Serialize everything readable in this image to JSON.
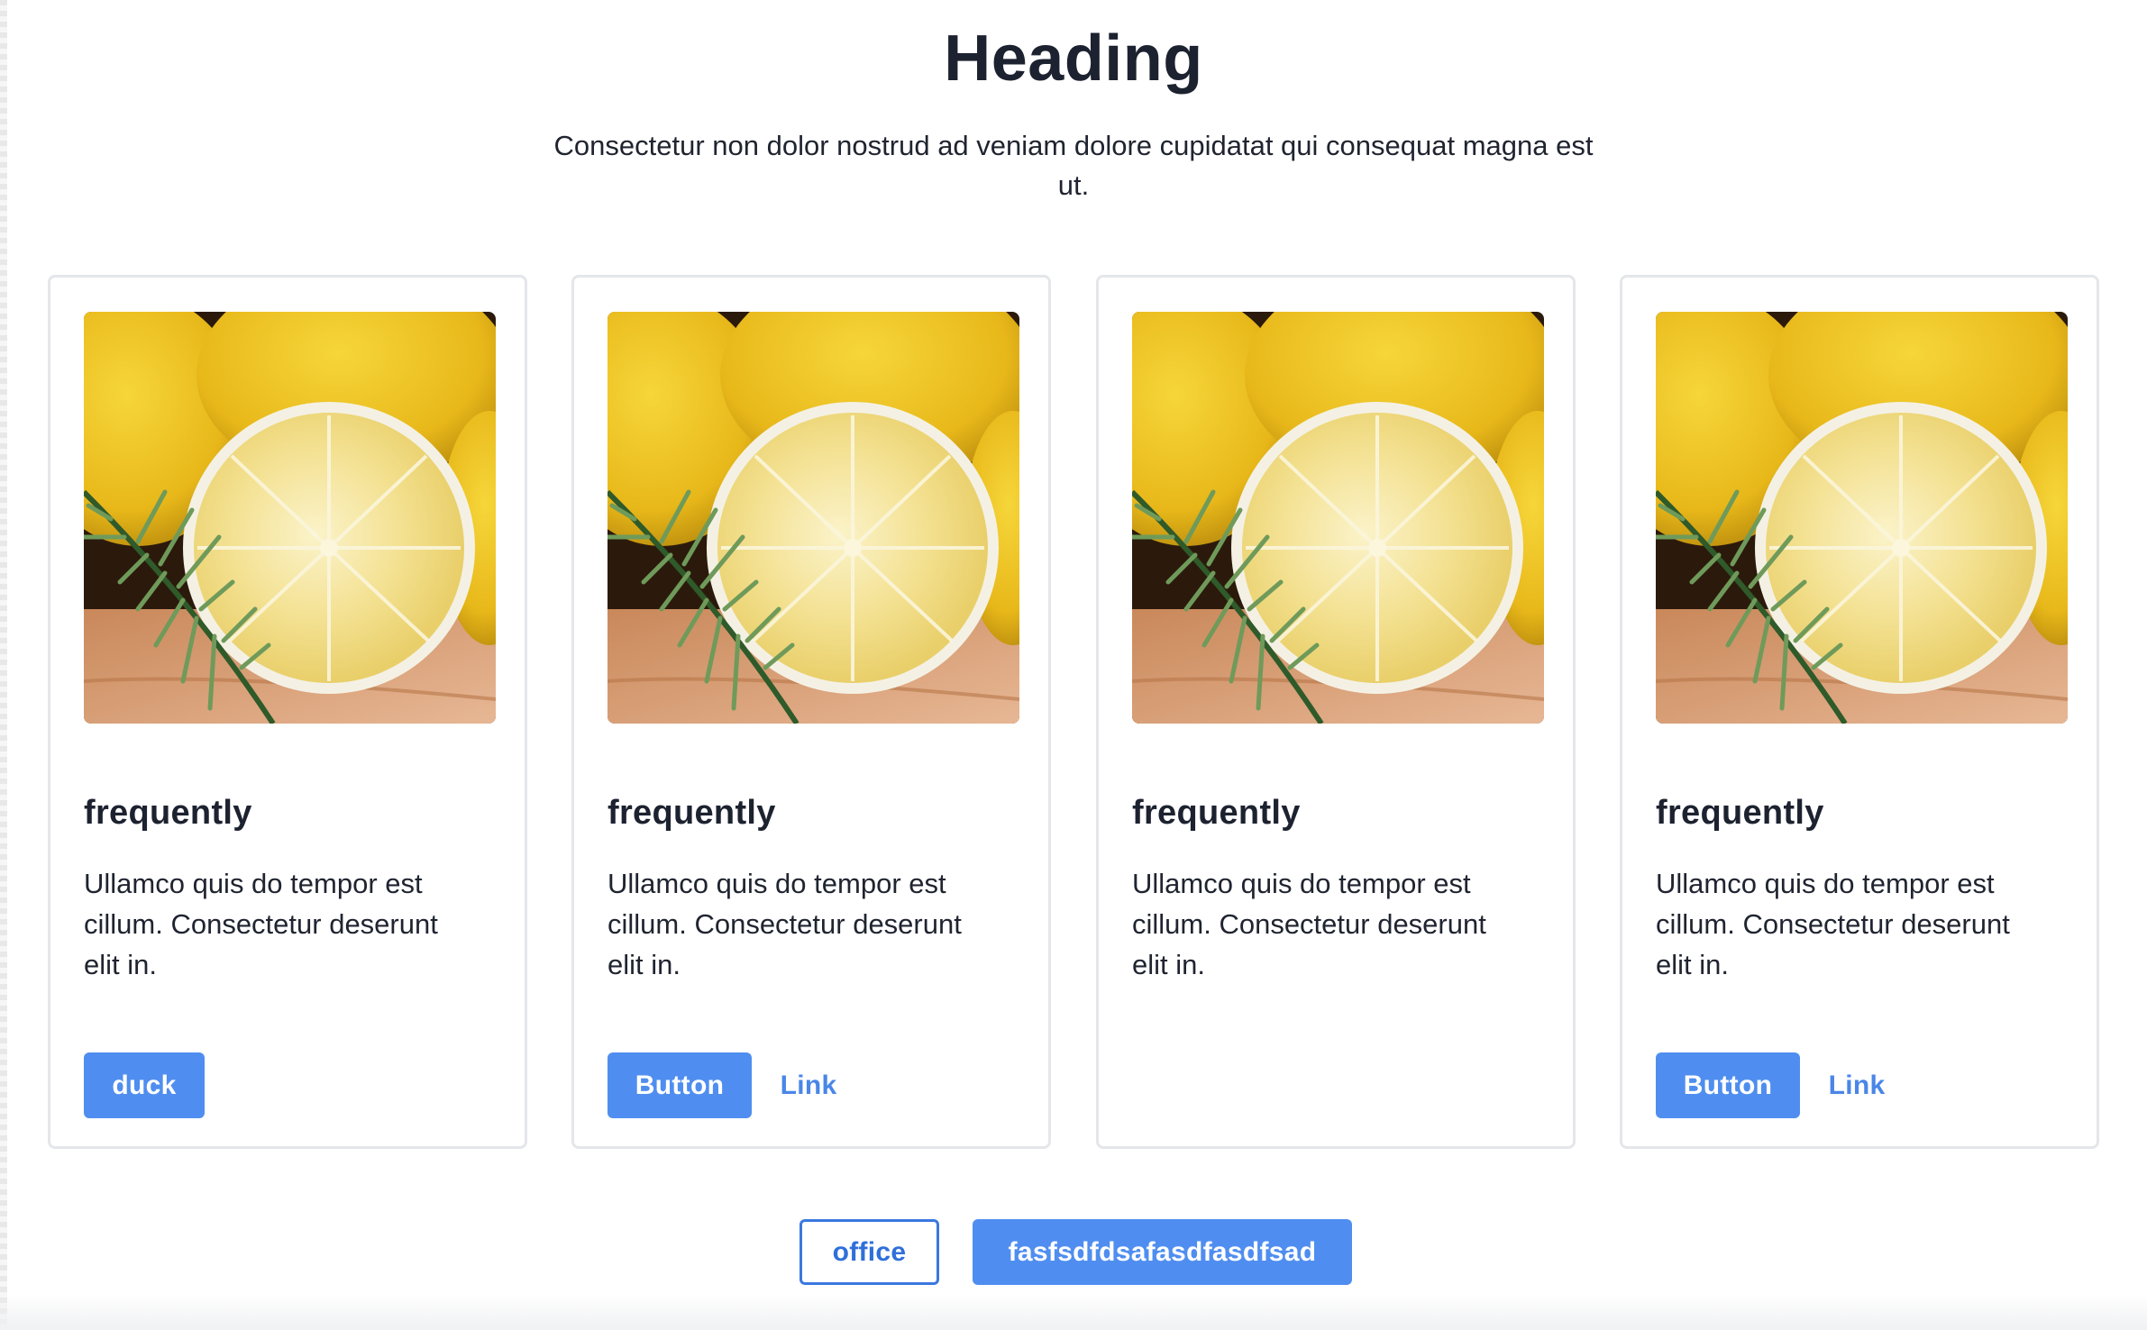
{
  "header": {
    "heading": "Heading",
    "subtitle": "Consectetur non dolor nostrud ad veniam dolore cupidatat qui consequat magna est ut."
  },
  "cards": [
    {
      "title": "frequently",
      "description": "Ullamco quis do tempor est cillum. Consectetur deserunt elit in.",
      "primary_button": "duck",
      "link": ""
    },
    {
      "title": "frequently",
      "description": "Ullamco quis do tempor est cillum. Consectetur deserunt elit in.",
      "primary_button": "Button",
      "link": "Link"
    },
    {
      "title": "frequently",
      "description": "Ullamco quis do tempor est cillum. Consectetur deserunt elit in.",
      "primary_button": "",
      "link": ""
    },
    {
      "title": "frequently",
      "description": "Ullamco quis do tempor est cillum. Consectetur deserunt elit in.",
      "primary_button": "Button",
      "link": "Link"
    }
  ],
  "footer_buttons": {
    "outline": "office",
    "primary": "fasfsdfdsafasdfasdfsad"
  },
  "colors": {
    "primary": "#4f8ef0",
    "link": "#4a86e8",
    "text": "#1d2230",
    "card_border": "#e4e6ea"
  },
  "image": {
    "icon": "lemon-photo"
  }
}
